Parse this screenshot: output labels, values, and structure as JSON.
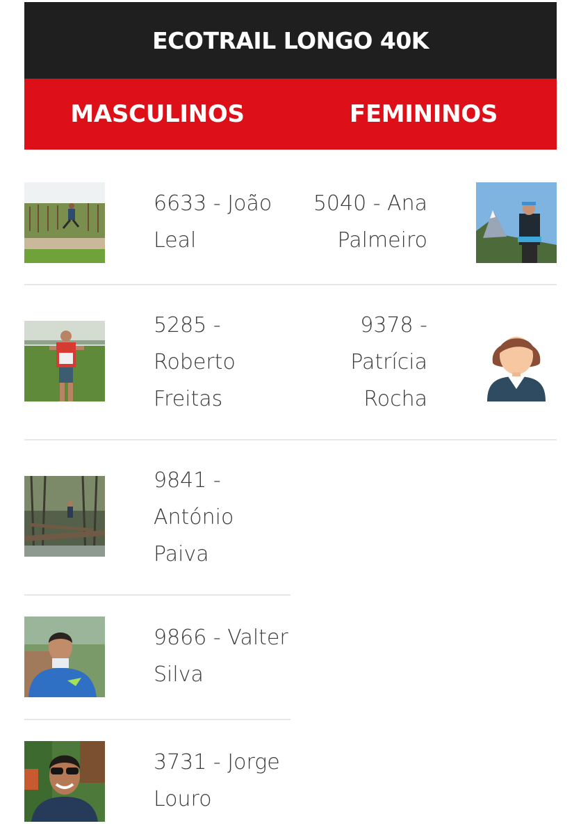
{
  "header": {
    "title": "ECOTRAIL LONGO 40K"
  },
  "tabs": [
    {
      "label": "MASCULINOS"
    },
    {
      "label": "FEMININOS"
    }
  ],
  "rows": [
    {
      "male": "6633 - João Leal",
      "female": "5040 - Ana Palmeiro"
    },
    {
      "male": "5285 - Roberto Freitas",
      "female": "9378 - Patrícia Rocha"
    },
    {
      "male": "9841 - António Paiva"
    },
    {
      "male": "9866 - Valter Silva"
    },
    {
      "male": "3731 - Jorge Louro"
    }
  ]
}
